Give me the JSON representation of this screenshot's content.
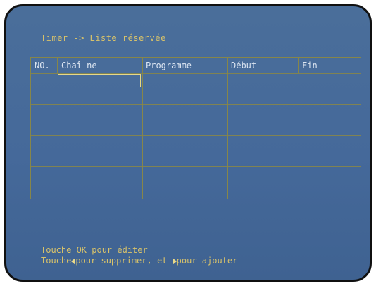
{
  "title": "Timer -> Liste réservée",
  "table": {
    "headers": [
      "NO.",
      "Chaî ne",
      "Programme",
      "Début",
      "Fin"
    ],
    "rows": 8
  },
  "help": {
    "line1": "Touche OK pour éditer",
    "line2_a": "Touche",
    "line2_b": "pour supprimer, et ",
    "line2_c": "pour ajouter"
  },
  "icons": [
    "left-arrow-icon",
    "right-arrow-icon"
  ]
}
